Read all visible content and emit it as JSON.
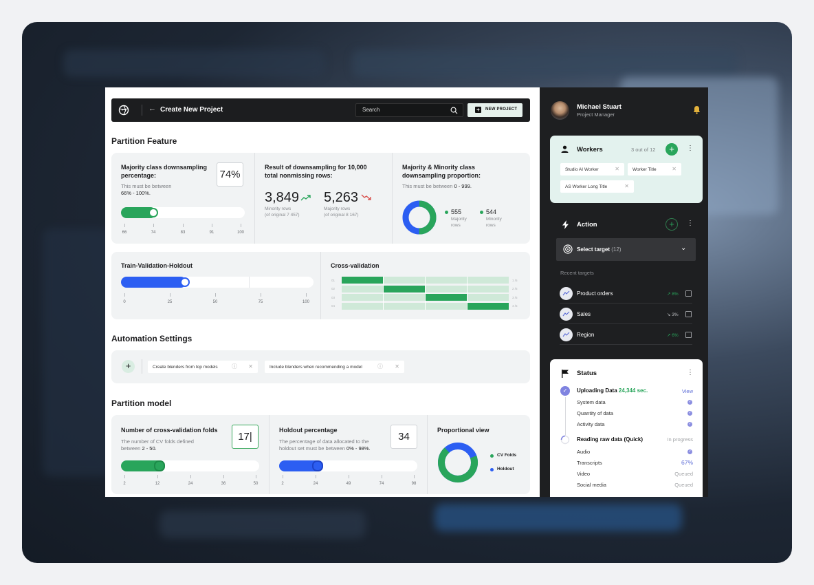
{
  "header": {
    "title": "Create New Project",
    "search_placeholder": "Search",
    "new_project_label": "NEW PROJECT"
  },
  "partition_feature": {
    "heading": "Partition Feature",
    "majority_class": {
      "title": "Majority class downsampling percentage:",
      "value": "74%",
      "hint_prefix": "This must be between",
      "hint_range": "66% - 100%.",
      "slider_percent": 24,
      "ticks": [
        "66",
        "74",
        "83",
        "91",
        "100"
      ]
    },
    "result": {
      "title": "Result of downsampling for 10,000 total nonmissing rows:",
      "minority_value": "3,849",
      "minority_label": "Minority rows",
      "minority_original": "(of original 7 457)",
      "majority_value": "5,263",
      "majority_label": "Majority rows",
      "majority_original": "(of original 8 167)"
    },
    "proportion": {
      "title": "Majority & Minority class downsampling proportion:",
      "hint_prefix": "This must be between",
      "hint_range": "0 - 999.",
      "majority_value": "555",
      "majority_label": "Majority rows",
      "minority_value": "544",
      "minority_label": "Minority rows"
    },
    "holdout": {
      "title": "Train-Validation-Holdout",
      "slider_percent": 33,
      "ticks": [
        "0",
        "25",
        "50",
        "75",
        "100"
      ]
    },
    "cross_validation": {
      "title": "Cross-validation",
      "row_left": [
        "01",
        "02",
        "03",
        "04"
      ],
      "row_right": [
        "1 /5",
        "2 /5",
        "3 /5",
        "4 /5"
      ]
    }
  },
  "automation": {
    "heading": "Automation Settings",
    "tags": [
      "Create blenders from top models",
      "Include blenders when recommending a model"
    ]
  },
  "partition_model": {
    "heading": "Partition model",
    "folds": {
      "title": "Number of cross-validation folds",
      "value": "17",
      "hint_prefix": "The number of CV folds defined between",
      "hint_range": "2 - 50.",
      "slider_percent": 31,
      "ticks": [
        "2",
        "12",
        "24",
        "36",
        "50"
      ]
    },
    "holdout_pct": {
      "title": "Holdout percentage",
      "value": "34",
      "hint_prefix": "The percentage of data allocated to the holdout set must be between",
      "hint_range": "0% - 98%.",
      "slider_percent": 31,
      "ticks": [
        "2",
        "24",
        "49",
        "74",
        "98"
      ]
    },
    "proportional": {
      "title": "Proportional view",
      "legend": [
        "CV Folds",
        "Holdout"
      ]
    }
  },
  "side": {
    "user_name": "Michael Stuart",
    "user_role": "Project Manager",
    "workers": {
      "title": "Workers",
      "count": "3 out of 12",
      "chips": [
        "Studio AI Worker",
        "Worker Title",
        "AS Worker Long Title"
      ]
    },
    "action": {
      "title": "Action",
      "select_label": "Select target",
      "select_count": "(12)",
      "recent_label": "Recent targets",
      "targets": [
        {
          "name": "Product orders",
          "pct": "8%",
          "trend": "up"
        },
        {
          "name": "Sales",
          "pct": "3%",
          "trend": "down"
        },
        {
          "name": "Region",
          "pct": "6%",
          "trend": "up"
        }
      ]
    },
    "status": {
      "title": "Status",
      "uploading_label": "Uploading Data",
      "uploading_time": "24,344 sec.",
      "view_label": "View",
      "upload_items": [
        "System data",
        "Quantity of data",
        "Activity data"
      ],
      "reading_label": "Reading raw data (Quick)",
      "reading_state": "In progress",
      "read_items": [
        {
          "name": "Audio",
          "state": ""
        },
        {
          "name": "Transcripts",
          "state": "67%"
        },
        {
          "name": "Video",
          "state": "Queued"
        },
        {
          "name": "Social media",
          "state": "Queued"
        }
      ]
    }
  },
  "colors": {
    "green": "#29a55b",
    "blue": "#2c5ef2",
    "dark": "#1e1f21",
    "mint": "#e3f2ee"
  }
}
